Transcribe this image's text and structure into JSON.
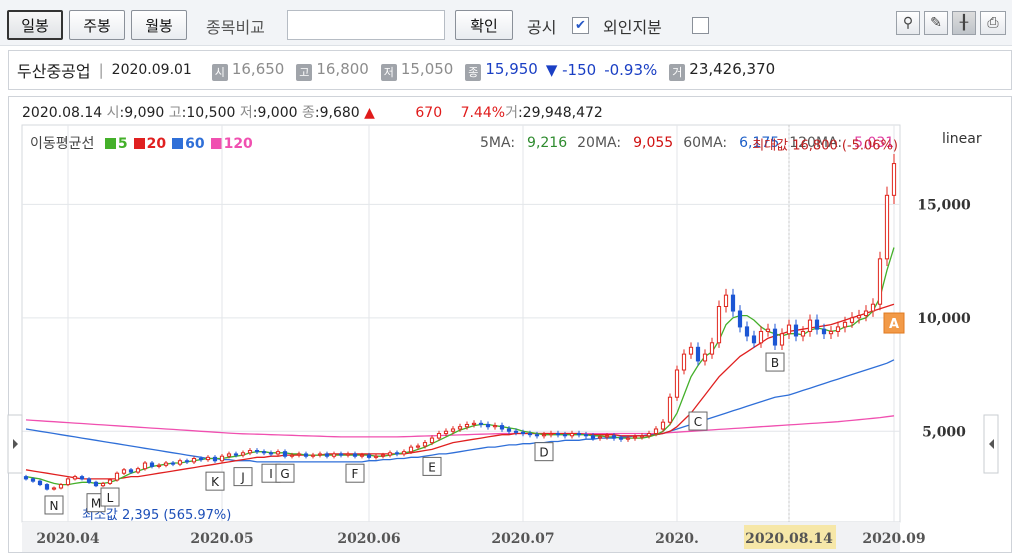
{
  "toolbar": {
    "daily": "일봉",
    "weekly": "주봉",
    "monthly": "월봉",
    "compare_label": "종목비교",
    "compare_value": "",
    "confirm": "확인",
    "disclosure": "공시",
    "foreign": "외인지분",
    "disclosure_checked": true,
    "foreign_checked": false,
    "tools": [
      "marker-icon",
      "pen-icon",
      "crosshair-icon",
      "print-icon"
    ]
  },
  "stock": {
    "name": "두산중공업",
    "date": "2020.09.01",
    "open_tag": "시",
    "open": "16,650",
    "high_tag": "고",
    "high": "16,800",
    "low_tag": "저",
    "low": "15,050",
    "close_tag": "종",
    "close": "15,950",
    "change": "▼ -150",
    "change_pct": "-0.93%",
    "volume_tag": "거",
    "volume": "23,426,370"
  },
  "cursor": {
    "date": "2020.08.14",
    "open_label": "시",
    "open": "9,090",
    "high_label": "고",
    "high": "10,500",
    "low_label": "저",
    "low": "9,000",
    "close_label": "종",
    "close": "9,680",
    "arrow": "▲",
    "change": "670",
    "change_pct": "7.44%",
    "volume_label": "거",
    "volume": "29,948,472"
  },
  "chart_data": {
    "type": "candlestick",
    "title": "",
    "scale": "linear",
    "legend_title": "이동평균선",
    "ma_legend": [
      {
        "name": "5",
        "color": "#44b02a"
      },
      {
        "name": "20",
        "color": "#e02020"
      },
      {
        "name": "60",
        "color": "#2f6fd8"
      },
      {
        "name": "120",
        "color": "#f050b0"
      }
    ],
    "ma_values": [
      {
        "label": "5MA:",
        "value": "9,216",
        "color": "#2e8b2e"
      },
      {
        "label": "20MA:",
        "value": "9,055",
        "color": "#d01010"
      },
      {
        "label": "60MA:",
        "value": "6,175",
        "color": "#1d5fc8"
      },
      {
        "label": "120MA:",
        "value": "5,031",
        "color": "#e03ca0"
      }
    ],
    "y_ticks": [
      "5,000",
      "10,000",
      "15,000"
    ],
    "y_tick_values": [
      5000,
      10000,
      15000
    ],
    "ylim": [
      1000,
      18500
    ],
    "x_ticks": [
      "2020.04",
      "2020.05",
      "2020.06",
      "2020.07",
      "2020.",
      "2020.08.14",
      "2020.09"
    ],
    "x_tick_index": [
      6,
      28,
      49,
      71,
      93,
      109,
      124
    ],
    "n_sessions": 125,
    "cursor_index": 109,
    "max_label": "최대값 16,800 (-5.06%)",
    "min_label": "최소값 2,395 (565.97%)",
    "markers": [
      "N",
      "M",
      "L",
      "K",
      "J",
      "I",
      "G",
      "F",
      "E",
      "D",
      "C",
      "B",
      "A"
    ],
    "marker_index": [
      4,
      10,
      12,
      27,
      31,
      35,
      37,
      47,
      58,
      74,
      96,
      107,
      124
    ],
    "close": [
      2900,
      2800,
      2650,
      2450,
      2500,
      2650,
      2900,
      3000,
      2900,
      2750,
      2600,
      2700,
      2850,
      3150,
      3300,
      3200,
      3350,
      3600,
      3450,
      3500,
      3600,
      3550,
      3700,
      3650,
      3800,
      3750,
      3850,
      3700,
      3900,
      4000,
      3950,
      4050,
      4150,
      4100,
      4050,
      4000,
      4100,
      3900,
      3950,
      4000,
      3900,
      3950,
      4000,
      3900,
      4000,
      3950,
      4000,
      3900,
      3950,
      3850,
      3900,
      3950,
      4050,
      4000,
      4100,
      4300,
      4350,
      4500,
      4700,
      4900,
      5000,
      5100,
      5200,
      5300,
      5350,
      5300,
      5200,
      5250,
      5100,
      5000,
      4950,
      4900,
      4850,
      4800,
      4850,
      4900,
      4850,
      4800,
      4900,
      4850,
      4800,
      4700,
      4750,
      4800,
      4700,
      4650,
      4700,
      4750,
      4800,
      4900,
      5100,
      5400,
      6500,
      7700,
      8400,
      8700,
      8100,
      8400,
      8900,
      10500,
      11000,
      10300,
      9600,
      9200,
      8900,
      9400,
      9500,
      8800,
      9300,
      9680,
      9200,
      9400,
      9900,
      9500,
      9300,
      9400,
      9600,
      9800,
      10000,
      10100,
      10300,
      10600,
      12600,
      15400,
      16800
    ],
    "ma5": [
      3000,
      2950,
      2900,
      2800,
      2700,
      2650,
      2650,
      2700,
      2750,
      2750,
      2700,
      2700,
      2750,
      2850,
      3000,
      3150,
      3250,
      3350,
      3450,
      3500,
      3550,
      3600,
      3600,
      3650,
      3700,
      3750,
      3800,
      3800,
      3800,
      3850,
      3900,
      3950,
      4050,
      4100,
      4100,
      4050,
      4050,
      4050,
      4000,
      4000,
      3950,
      3950,
      3950,
      3950,
      3950,
      3950,
      3950,
      3950,
      3950,
      3950,
      3900,
      3900,
      3950,
      4000,
      4050,
      4100,
      4200,
      4300,
      4450,
      4600,
      4750,
      4900,
      5050,
      5150,
      5250,
      5300,
      5300,
      5250,
      5200,
      5150,
      5100,
      5000,
      4950,
      4900,
      4850,
      4850,
      4850,
      4850,
      4850,
      4850,
      4850,
      4800,
      4800,
      4750,
      4750,
      4700,
      4700,
      4700,
      4700,
      4750,
      4850,
      5000,
      5300,
      5800,
      6600,
      7400,
      7900,
      8300,
      8500,
      9000,
      9700,
      10000,
      10100,
      10100,
      9900,
      9600,
      9400,
      9300,
      9200,
      9300,
      9300,
      9250,
      9450,
      9550,
      9500,
      9400,
      9450,
      9600,
      9650,
      9900,
      10000,
      10300,
      10900,
      12100,
      13100
    ],
    "ma20": [
      3300,
      3250,
      3200,
      3150,
      3100,
      3050,
      3000,
      2950,
      2900,
      2900,
      2900,
      2900,
      2900,
      2900,
      2950,
      3000,
      3000,
      3050,
      3100,
      3150,
      3200,
      3250,
      3300,
      3350,
      3400,
      3450,
      3500,
      3550,
      3600,
      3650,
      3700,
      3750,
      3800,
      3850,
      3850,
      3900,
      3900,
      3950,
      3950,
      3950,
      3950,
      3950,
      3950,
      4000,
      4000,
      4000,
      4000,
      4000,
      4000,
      4000,
      4000,
      4000,
      4000,
      4000,
      4000,
      4050,
      4100,
      4150,
      4200,
      4300,
      4400,
      4500,
      4550,
      4600,
      4650,
      4700,
      4750,
      4800,
      4850,
      4850,
      4900,
      4900,
      4900,
      4900,
      4900,
      4900,
      4900,
      4900,
      4900,
      4900,
      4850,
      4850,
      4850,
      4850,
      4850,
      4800,
      4800,
      4800,
      4800,
      4800,
      4850,
      4900,
      5000,
      5200,
      5500,
      5800,
      6200,
      6600,
      7000,
      7400,
      7700,
      8000,
      8300,
      8500,
      8700,
      8900,
      9100,
      9200,
      9300,
      9400,
      9450,
      9500,
      9550,
      9600,
      9650,
      9700,
      9800,
      9900,
      10000,
      10100,
      10200,
      10300,
      10400,
      10500,
      10600
    ],
    "ma60": [
      5100,
      5050,
      5000,
      4950,
      4900,
      4850,
      4800,
      4750,
      4700,
      4650,
      4600,
      4550,
      4500,
      4450,
      4400,
      4350,
      4300,
      4250,
      4200,
      4150,
      4100,
      4050,
      4000,
      3950,
      3900,
      3850,
      3800,
      3800,
      3750,
      3750,
      3700,
      3700,
      3700,
      3650,
      3650,
      3650,
      3650,
      3650,
      3650,
      3650,
      3650,
      3650,
      3650,
      3650,
      3650,
      3650,
      3650,
      3650,
      3650,
      3700,
      3700,
      3750,
      3750,
      3800,
      3800,
      3850,
      3850,
      3900,
      3950,
      4000,
      4000,
      4050,
      4100,
      4150,
      4200,
      4250,
      4300,
      4300,
      4350,
      4400,
      4400,
      4450,
      4450,
      4500,
      4500,
      4550,
      4550,
      4600,
      4600,
      4600,
      4650,
      4650,
      4700,
      4700,
      4700,
      4750,
      4750,
      4800,
      4800,
      4850,
      4850,
      4900,
      5000,
      5100,
      5200,
      5300,
      5400,
      5500,
      5600,
      5700,
      5800,
      5900,
      6000,
      6100,
      6200,
      6300,
      6400,
      6500,
      6550,
      6600,
      6700,
      6800,
      6900,
      7000,
      7100,
      7200,
      7300,
      7400,
      7500,
      7600,
      7700,
      7800,
      7900,
      8000,
      8150
    ],
    "ma120": [
      5500,
      5480,
      5460,
      5440,
      5420,
      5400,
      5380,
      5360,
      5340,
      5320,
      5300,
      5280,
      5260,
      5240,
      5220,
      5200,
      5180,
      5160,
      5140,
      5120,
      5100,
      5080,
      5060,
      5040,
      5020,
      5000,
      4980,
      4960,
      4940,
      4920,
      4900,
      4890,
      4880,
      4870,
      4860,
      4850,
      4840,
      4830,
      4820,
      4810,
      4800,
      4790,
      4780,
      4770,
      4760,
      4750,
      4750,
      4750,
      4750,
      4750,
      4750,
      4750,
      4750,
      4750,
      4760,
      4770,
      4780,
      4790,
      4800,
      4810,
      4820,
      4830,
      4840,
      4850,
      4860,
      4870,
      4880,
      4890,
      4900,
      4900,
      4900,
      4900,
      4900,
      4900,
      4900,
      4900,
      4900,
      4900,
      4900,
      4900,
      4900,
      4900,
      4900,
      4900,
      4900,
      4900,
      4900,
      4900,
      4900,
      4900,
      4900,
      4920,
      4940,
      4960,
      4980,
      5000,
      5020,
      5040,
      5060,
      5080,
      5100,
      5120,
      5140,
      5160,
      5180,
      5200,
      5220,
      5240,
      5260,
      5280,
      5300,
      5320,
      5340,
      5360,
      5380,
      5400,
      5420,
      5450,
      5480,
      5510,
      5540,
      5570,
      5600,
      5640,
      5680
    ]
  }
}
